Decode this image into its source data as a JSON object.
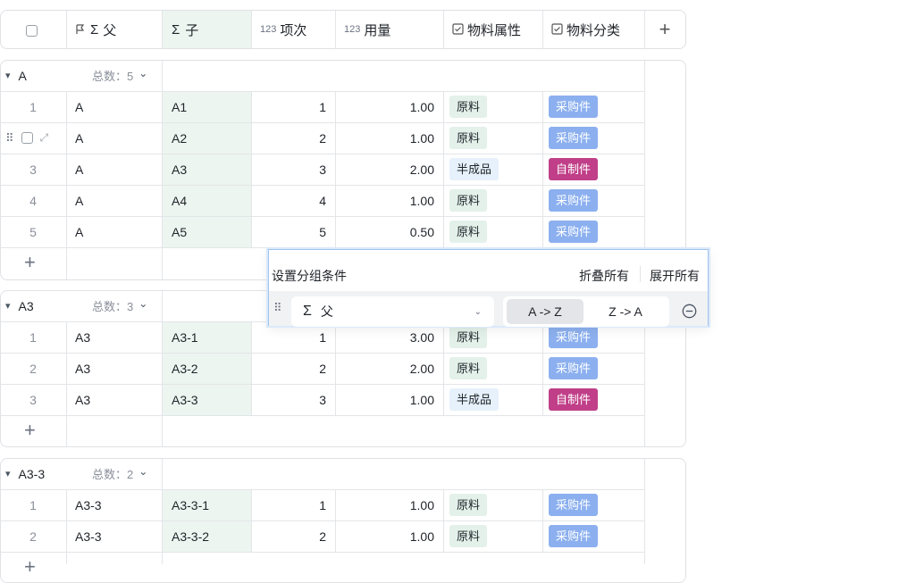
{
  "header": {
    "col_parent": "父",
    "col_child": "子",
    "col_item_no": "项次",
    "col_qty": "用量",
    "col_attr": "物料属性",
    "col_class": "物料分类",
    "num_prefix": "123"
  },
  "groups": [
    {
      "title": "A",
      "count": "总数：5",
      "rows": [
        {
          "no": "1",
          "parent": "A",
          "child": "A1",
          "item": "1",
          "qty": "1.00",
          "attr": "原料",
          "cls": "采购件"
        },
        {
          "no": "2",
          "parent": "A",
          "child": "A2",
          "item": "2",
          "qty": "1.00",
          "attr": "原料",
          "cls": "采购件"
        },
        {
          "no": "3",
          "parent": "A",
          "child": "A3",
          "item": "3",
          "qty": "2.00",
          "attr": "半成品",
          "cls": "自制件"
        },
        {
          "no": "4",
          "parent": "A",
          "child": "A4",
          "item": "4",
          "qty": "1.00",
          "attr": "原料",
          "cls": "采购件"
        },
        {
          "no": "5",
          "parent": "A",
          "child": "A5",
          "item": "5",
          "qty": "0.50",
          "attr": "原料",
          "cls": "采购件"
        }
      ]
    },
    {
      "title": "A3",
      "count": "总数：3",
      "rows": [
        {
          "no": "1",
          "parent": "A3",
          "child": "A3-1",
          "item": "1",
          "qty": "3.00",
          "attr": "原料",
          "cls": "采购件"
        },
        {
          "no": "2",
          "parent": "A3",
          "child": "A3-2",
          "item": "2",
          "qty": "2.00",
          "attr": "原料",
          "cls": "采购件"
        },
        {
          "no": "3",
          "parent": "A3",
          "child": "A3-3",
          "item": "3",
          "qty": "1.00",
          "attr": "半成品",
          "cls": "自制件"
        }
      ]
    },
    {
      "title": "A3-3",
      "count": "总数：2",
      "rows": [
        {
          "no": "1",
          "parent": "A3-3",
          "child": "A3-3-1",
          "item": "1",
          "qty": "1.00",
          "attr": "原料",
          "cls": "采购件"
        },
        {
          "no": "2",
          "parent": "A3-3",
          "child": "A3-3-2",
          "item": "2",
          "qty": "1.00",
          "attr": "原料",
          "cls": "采购件"
        }
      ]
    }
  ],
  "group_popup": {
    "title": "设置分组条件",
    "collapse_all": "折叠所有",
    "expand_all": "展开所有",
    "field": "父",
    "sort_asc": "A -> Z",
    "sort_desc": "Z -> A"
  },
  "colors": {
    "tag_material": "#e3f1ea",
    "tag_semi": "#e6f1fb",
    "tag_purchase": "#8cb0ef",
    "tag_selfmade": "#c03f88",
    "child_column_tint": "#edf5f0",
    "popup_border": "#9fc3ee"
  },
  "icons": [
    "checkbox-icon",
    "primary-flag-icon",
    "sigma-icon",
    "number-icon",
    "formula-icon",
    "add-column-icon",
    "chevron-down-icon",
    "drag-handle-icon",
    "expand-icon",
    "add-row-icon",
    "remove-icon"
  ]
}
